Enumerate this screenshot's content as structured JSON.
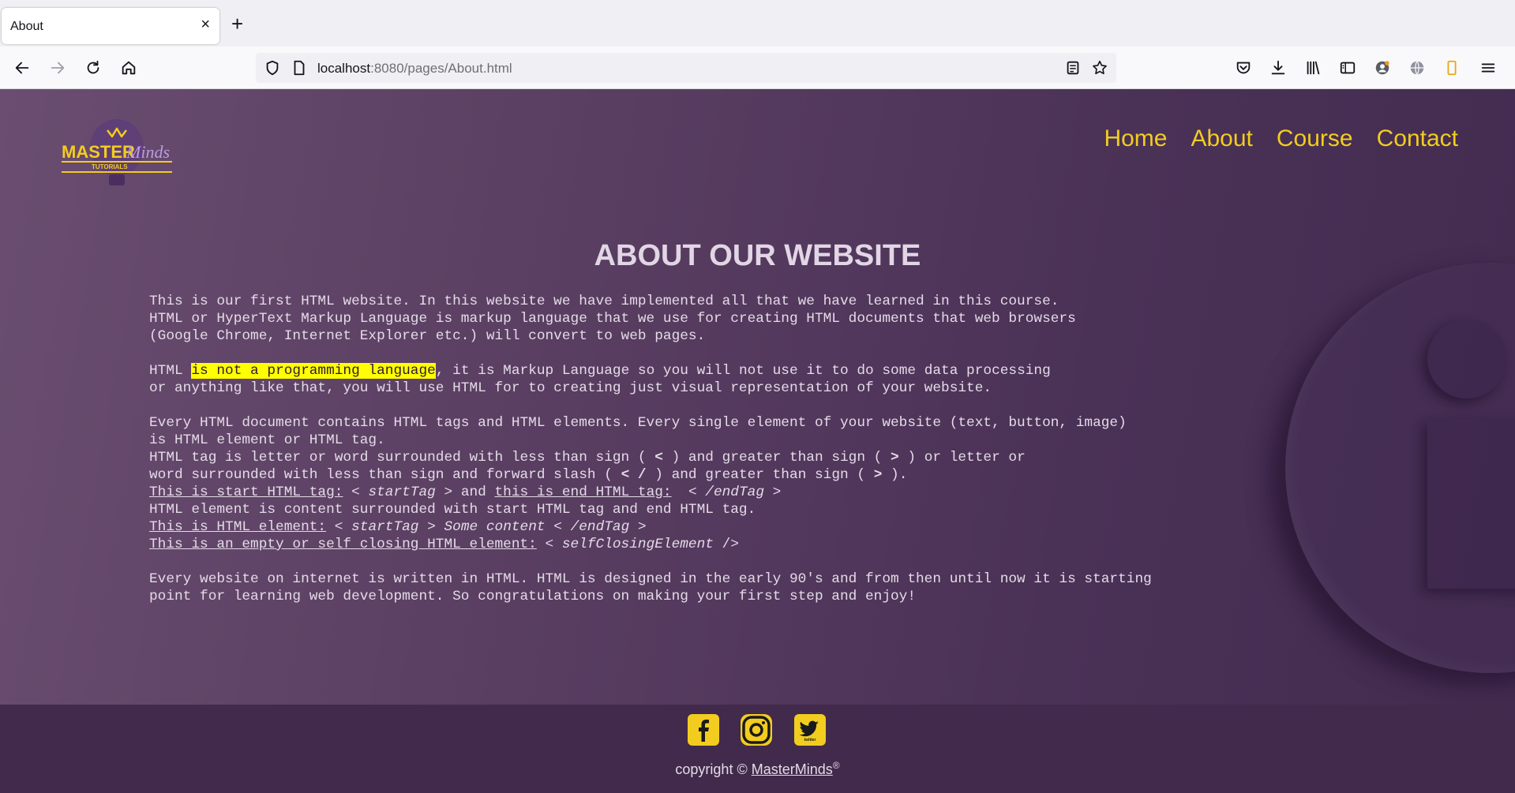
{
  "browser": {
    "tab_title": "About",
    "tab_close": "×",
    "new_tab": "+",
    "url_host": "localhost",
    "url_rest": ":8080/pages/About.html"
  },
  "site": {
    "logo_text_main": "MASTER",
    "logo_text_script": "Minds",
    "logo_text_sub": "TUTORIALS",
    "nav": [
      "Home",
      "About",
      "Course",
      "Contact"
    ],
    "heading": "ABOUT OUR WEBSITE"
  },
  "content": {
    "p1": [
      "This is our first HTML website. In this website we have implemented all that we have learned in this course.",
      "HTML or HyperText Markup Language is markup language that we use for creating HTML documents that web browsers",
      "(Google Chrome, Internet Explorer etc.) will convert to web pages."
    ],
    "p2_start": "HTML ",
    "p2_highlight": "is not a programming language",
    "p2_rest": ", it is Markup Language so you will not use it to do some data processing",
    "p2_line2": "or anything like that, you will use HTML for to creating just visual representation of your website.",
    "p3_l1": "Every HTML document contains HTML tags and HTML elements. Every single element of your website (text, button, image)",
    "p3_l2": "is HTML element or HTML tag.",
    "p3_l3a": "HTML tag is letter or word surrounded with less than sign ( ",
    "p3_l3b": "<",
    "p3_l3c": " ) and greater than sign ( ",
    "p3_l3d": ">",
    "p3_l3e": " ) or letter or",
    "p3_l4a": "word surrounded with less than sign and forward slash ( ",
    "p3_l4b": "< /",
    "p3_l4c": " ) and greater than sign ( ",
    "p3_l4d": ">",
    "p3_l4e": " ).",
    "p3_l5a": "This is start HTML tag:",
    "p3_l5b": " < ",
    "p3_l5c": "startTag",
    "p3_l5d": " > and ",
    "p3_l5e": "this is end HTML tag:",
    "p3_l5f": "  < ",
    "p3_l5g": "/endTag",
    "p3_l5h": " >",
    "p3_l6": "HTML element is content surrounded with start HTML tag and end HTML tag.",
    "p3_l7a": "This is HTML element:",
    "p3_l7b": " < ",
    "p3_l7c": "startTag",
    "p3_l7d": " > ",
    "p3_l7e": "Some content",
    "p3_l7f": " < ",
    "p3_l7g": "/endTag",
    "p3_l7h": " >",
    "p3_l8a": "This is an empty or self closing HTML element:",
    "p3_l8b": " < ",
    "p3_l8c": "selfClosingElement",
    "p3_l8d": " />",
    "p4": [
      "Every website on internet is written in HTML. HTML is designed in the early 90's and from then until now it is starting",
      "point for learning web development. So congratulations on making your first step and enjoy!"
    ]
  },
  "footer": {
    "copyright_prefix": "copyright © ",
    "copyright_link": "MasterMinds",
    "copyright_reg": "®",
    "twitter_text": "twitter"
  },
  "colors": {
    "accent": "#f2cd1f",
    "page_bg": "#5a3f62",
    "footer_bg": "#412a4b",
    "highlight": "#ffff00"
  }
}
